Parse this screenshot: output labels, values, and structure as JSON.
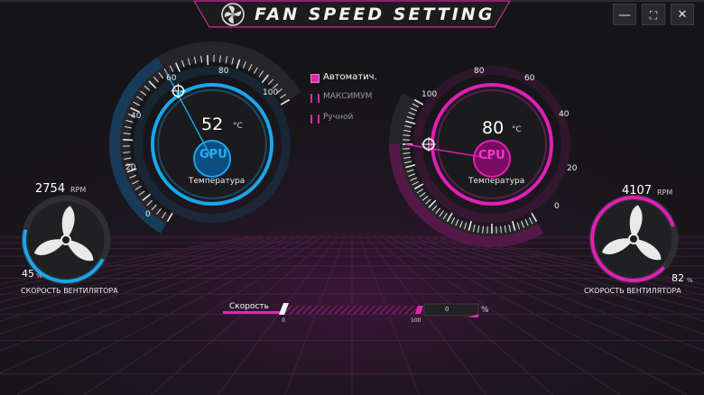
{
  "title_bar": {
    "app_title": "FAN SPEED SETTING",
    "minimize_label": "—",
    "maximize_label": "⛶",
    "close_label": "✕"
  },
  "gpu": {
    "label": "GPU",
    "temperature": "52",
    "temperature_unit": "°C",
    "temperature_caption": "Температура",
    "ticks": [
      "0",
      "20",
      "40",
      "60",
      "80",
      "100"
    ],
    "needle_value": 56,
    "fan_rpm": "2754",
    "fan_rpm_unit": "RPM",
    "fan_percent": "45",
    "fan_percent_unit": "%",
    "fan_caption": "СКОРОСТЬ ВЕНТИЛЯТОРА",
    "fan_level": 0.45,
    "accent_color": "#19a6ee"
  },
  "cpu": {
    "label": "CPU",
    "temperature": "80",
    "temperature_unit": "°C",
    "temperature_caption": "Температура",
    "ticks": [
      "0",
      "20",
      "40",
      "60",
      "80",
      "100"
    ],
    "needle_value": 80,
    "fan_rpm": "4107",
    "fan_rpm_unit": "RPM",
    "fan_percent": "82",
    "fan_percent_unit": "%",
    "fan_caption": "СКОРОСТЬ ВЕНТИЛЯТОРА",
    "fan_level": 0.82,
    "accent_color": "#e01fb5"
  },
  "modes": {
    "options": [
      {
        "label": "Автоматич.",
        "checked": true
      },
      {
        "label": "МАКСИМУМ",
        "checked": false
      },
      {
        "label": "Ручной",
        "checked": false
      }
    ]
  },
  "speed": {
    "label": "Скорость",
    "min_label": "0",
    "max_label": "100",
    "value": "0",
    "unit": "%"
  },
  "icons": {
    "logo": "fan-logo-icon",
    "gpu_fan": "fan-blade-icon",
    "cpu_fan": "fan-blade-icon"
  }
}
